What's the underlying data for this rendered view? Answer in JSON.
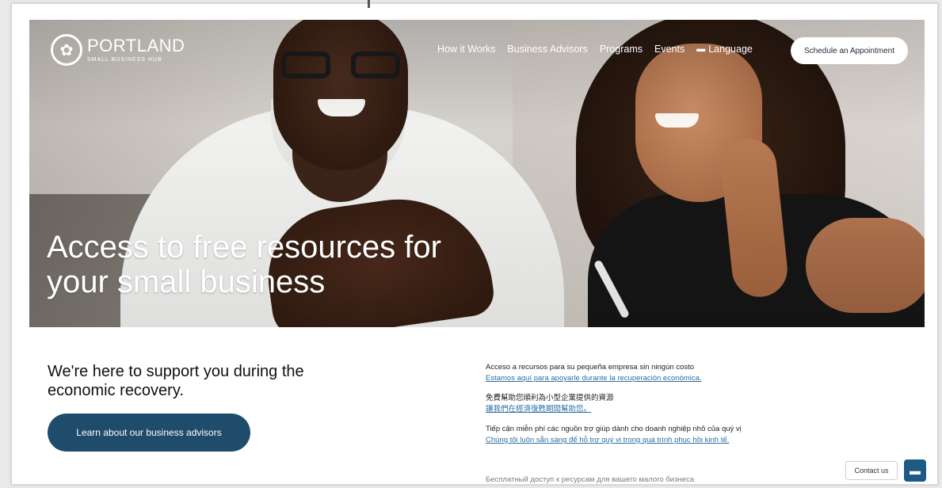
{
  "brand": {
    "name": "PORTLAND",
    "subtitle": "SMALL BUSINESS HUB",
    "logo_icon": "rose-icon"
  },
  "nav": {
    "items": [
      {
        "label": "How it Works"
      },
      {
        "label": "Business Advisors"
      },
      {
        "label": "Programs"
      },
      {
        "label": "Events"
      }
    ],
    "language_label": "Language",
    "language_icon": "flag-icon",
    "cta_label": "Schedule an Appointment"
  },
  "hero": {
    "title_line1": "Access to free resources for",
    "title_line2": "your small business"
  },
  "main": {
    "heading_line1": "We're here to support you during the",
    "heading_line2": "economic recovery.",
    "button_label": "Learn about our business advisors"
  },
  "translations": [
    {
      "title": "Acceso a recursos para su pequeña empresa sin ningún costo",
      "link": "Estamos aquí para apoyarle durante la recuperación económica."
    },
    {
      "title": "免費幫助您順利為小型企業提供的資源",
      "link": "讓我們在經濟復甦期間幫助您。"
    },
    {
      "title": "Tiếp cận miễn phí các nguồn trợ giúp dành cho doanh nghiệp nhỏ của quý vị",
      "link": "Chúng tôi luôn sẵn sàng để hỗ trợ quý vị trong quá trình phục hồi kinh tế."
    }
  ],
  "translations_cutoff": "Бесплатный доступ к ресурсам для вашего малого бизнеса",
  "contact": {
    "label": "Contact us",
    "chat_icon": "chat-icon"
  },
  "colors": {
    "primary_button": "#1f4c6b",
    "link": "#2a6fa5",
    "chat_button": "#1d5a85"
  }
}
